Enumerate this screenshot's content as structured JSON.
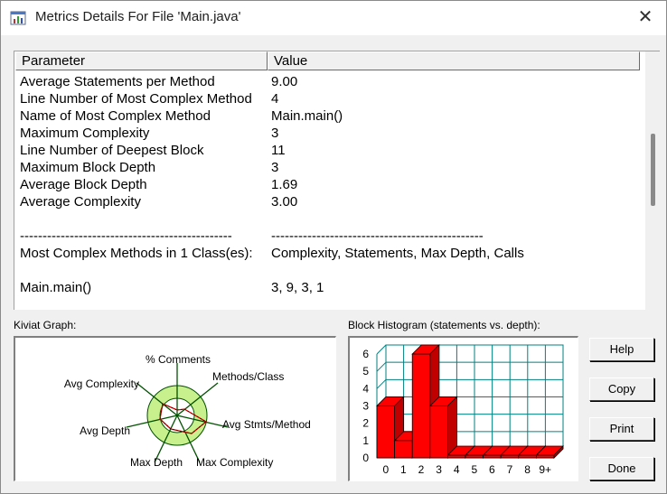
{
  "window": {
    "title": "Metrics Details For File 'Main.java'",
    "close_glyph": "✕"
  },
  "table": {
    "headers": {
      "parameter": "Parameter",
      "value": "Value"
    },
    "rows": [
      {
        "parameter": "Average Statements per Method",
        "value": "9.00"
      },
      {
        "parameter": "Line Number of Most Complex Method",
        "value": "4"
      },
      {
        "parameter": "Name of Most Complex Method",
        "value": "Main.main()"
      },
      {
        "parameter": "Maximum Complexity",
        "value": "3"
      },
      {
        "parameter": "Line Number of Deepest Block",
        "value": "11"
      },
      {
        "parameter": "Maximum Block Depth",
        "value": "3"
      },
      {
        "parameter": "Average Block Depth",
        "value": "1.69"
      },
      {
        "parameter": "Average Complexity",
        "value": "3.00"
      },
      {
        "parameter": "",
        "value": ""
      },
      {
        "parameter": "-----------------------------------------------",
        "value": "-----------------------------------------------"
      },
      {
        "parameter": "Most Complex Methods in 1 Class(es):",
        "value": "Complexity, Statements, Max Depth, Calls"
      },
      {
        "parameter": "",
        "value": ""
      },
      {
        "parameter": "Main.main()",
        "value": "3, 9, 3, 1"
      }
    ]
  },
  "kiviat": {
    "label": "Kiviat Graph:",
    "axes": [
      "% Comments",
      "Methods/Class",
      "Avg Stmts/Method",
      "Max Complexity",
      "Max Depth",
      "Avg Depth",
      "Avg Complexity"
    ]
  },
  "histogram": {
    "label": "Block Histogram (statements vs. depth):",
    "y_ticks": [
      "0",
      "1",
      "2",
      "3",
      "4",
      "5",
      "6"
    ],
    "categories": [
      "0",
      "1",
      "2",
      "3",
      "4",
      "5",
      "6",
      "7",
      "8",
      "9+"
    ],
    "values": [
      3,
      1,
      6,
      3,
      0,
      0,
      0,
      0,
      0,
      0
    ],
    "ylim": [
      0,
      6
    ],
    "bar_color": "#ff0000",
    "grid_color": "#008080"
  },
  "buttons": {
    "help": "Help",
    "copy": "Copy",
    "print": "Print",
    "done": "Done"
  }
}
